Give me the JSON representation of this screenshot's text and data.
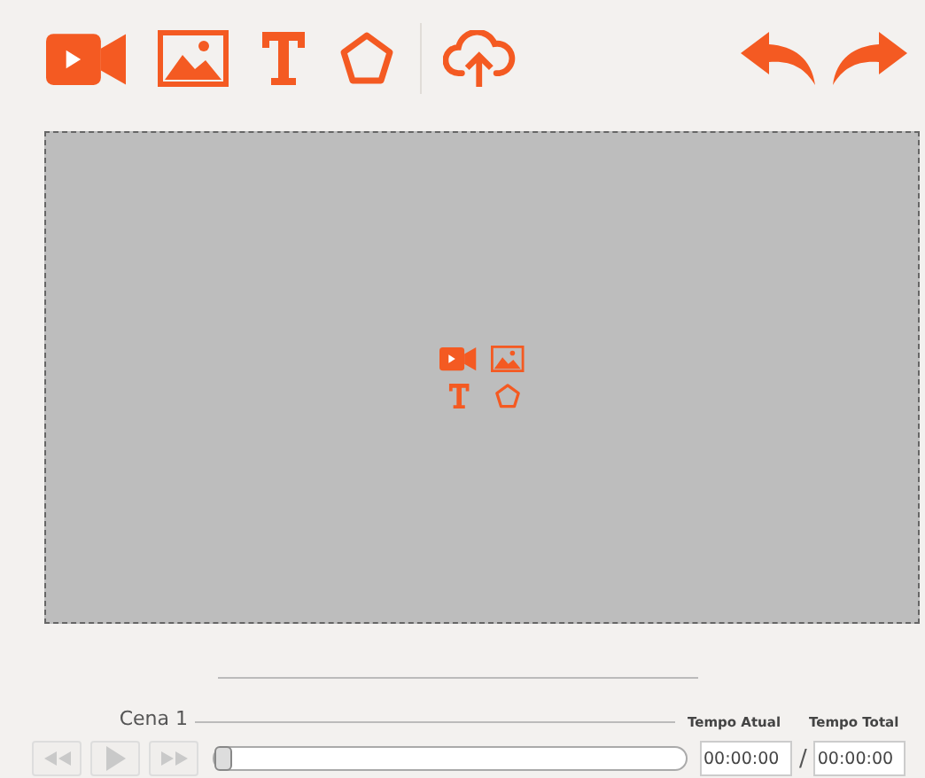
{
  "toolbar": {
    "tools": [
      {
        "kind": "video"
      },
      {
        "kind": "image"
      },
      {
        "kind": "text"
      },
      {
        "kind": "shape"
      }
    ],
    "actions": [
      {
        "kind": "upload"
      }
    ],
    "history": [
      {
        "kind": "undo"
      },
      {
        "kind": "redo"
      }
    ]
  },
  "canvas": {
    "placeholder_icons": [
      {
        "kind": "video"
      },
      {
        "kind": "image"
      },
      {
        "kind": "text"
      },
      {
        "kind": "shape"
      }
    ]
  },
  "timeline": {
    "scenes": [
      {
        "label": "Cena 1"
      }
    ],
    "transport": [
      {
        "kind": "rewind",
        "disabled": true
      },
      {
        "kind": "play",
        "disabled": true
      },
      {
        "kind": "forward",
        "disabled": true
      }
    ],
    "slider": {
      "level": 0
    },
    "current_time": {
      "label": "Tempo Atual",
      "value": "00:00:00"
    },
    "separator": "/",
    "total_time": {
      "label": "Tempo Total",
      "value": "00:00:00"
    }
  }
}
